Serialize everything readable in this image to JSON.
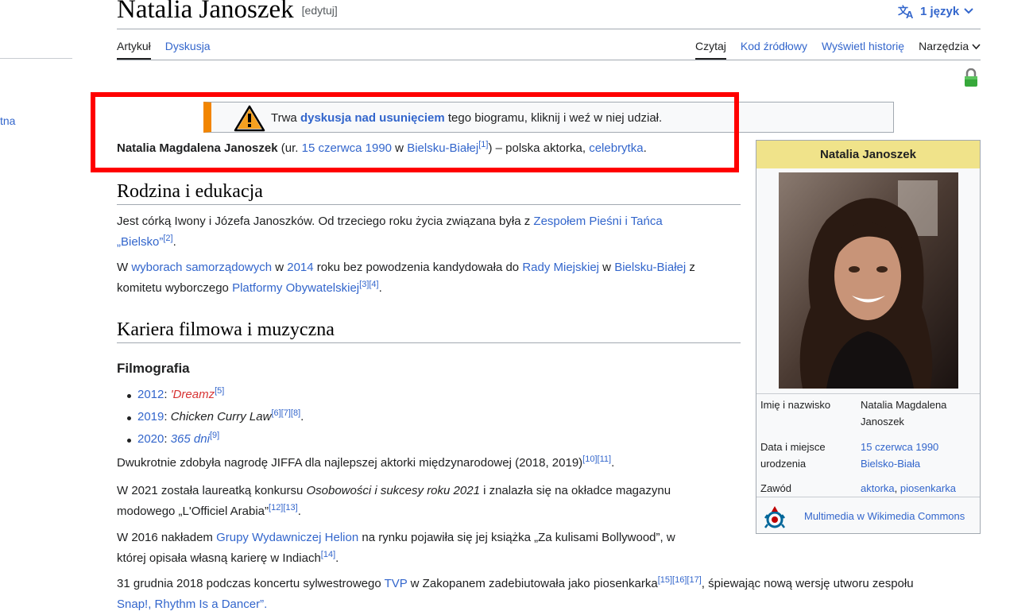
{
  "sidebar": {
    "partial_link": "tna"
  },
  "header": {
    "title": "Natalia Janoszek",
    "edit_label": "[edytuj]",
    "languages_label": "1 język"
  },
  "tabs": {
    "left": [
      "Artykuł",
      "Dyskusja"
    ],
    "right": [
      "Czytaj",
      "Kod źródłowy",
      "Wyświetl historię",
      "Narzędzia"
    ]
  },
  "notice": {
    "prefix": "Trwa ",
    "link": "dyskusja nad usunięciem",
    "suffix": " tego biogramu, kliknij i weź w niej udział."
  },
  "lead": {
    "name": "Natalia Magdalena Janoszek",
    "t1": " (ur. ",
    "birth_date": "15 czerwca 1990",
    "t2": " w ",
    "birth_place": "Bielsku-Białej",
    "ref1": "[1]",
    "t3": ") – polska aktorka, ",
    "celeb": "celebrytka",
    "t4": "."
  },
  "section1": {
    "heading": "Rodzina i edukacja",
    "p1": {
      "t1": "Jest córką Iwony i Józefa Janoszków. Od trzeciego roku życia związana była z ",
      "link1": "Zespołem Pieśni i Tańca",
      "link2": "„Bielsko”",
      "ref": "[2]",
      "t2": "."
    },
    "p2": {
      "t1": "W ",
      "link1": "wyborach samorządowych",
      "t2": " w ",
      "link2": "2014",
      "t3": " roku bez powodzenia kandydowała do ",
      "link3": "Rady Miejskiej",
      "t4": " w ",
      "link4": "Bielsku-Białej",
      "t5": " z",
      "t6": "komitetu wyborczego ",
      "link5": "Platformy Obywatelskiej",
      "ref1": "[3]",
      "ref2": "[4]",
      "t7": "."
    }
  },
  "section2": {
    "heading": "Kariera filmowa i muzyczna",
    "subheading": "Filmografia",
    "films": [
      {
        "year": "2012",
        "sep": ": ",
        "title": "'Dreamz",
        "refs": "[5]",
        "end": ""
      },
      {
        "year": "2019",
        "sep": ": ",
        "title": "Chicken Curry Law",
        "refs": "[6][7][8]",
        "end": "."
      },
      {
        "year": "2020",
        "sep": ": ",
        "title": "365 dni",
        "refs": "[9]",
        "end": ""
      }
    ],
    "p1": {
      "t1": "Dwukrotnie zdobyła nagrodę JIFFA dla najlepszej aktorki międzynarodowej (2018, 2019)",
      "refs": "[10][11]",
      "t2": "."
    },
    "p2": {
      "t1": "W 2021 została laureatką konkursu ",
      "em": "Osobowości i sukcesy roku 2021",
      "t2": " i znalazła się na okładce magazynu",
      "t3": "modowego „L'Officiel Arabia”",
      "refs": "[12][13]",
      "t4": "."
    },
    "p3": {
      "t1": "W 2016 nakładem ",
      "link": "Grupy Wydawniczej Helion",
      "t2": " na rynku pojawiła się jej książka „Za kulisami Bollywood”, w",
      "t3": "której opisała własną karierę w Indiach",
      "refs": "[14]",
      "t4": "."
    },
    "p4": {
      "t1": "31 grudnia 2018 podczas koncertu sylwestrowego ",
      "link": "TVP",
      "t2": " w Zakopanem zadebiutowała jako piosenkarka",
      "refs": "[15][16][17]",
      "t3": ", śpiewając nową wersję utworu zespołu",
      "t4": "Snap!, Rhythm Is a Dancer”."
    }
  },
  "infobox": {
    "title": "Natalia Janoszek",
    "name_label": "Imię i nazwisko",
    "name_value1": "Natalia Magdalena",
    "name_value2": "Janoszek",
    "birth_label1": "Data i miejsce",
    "birth_label2": "urodzenia",
    "birth_date": "15 czerwca 1990",
    "birth_place": "Bielsko-Biała",
    "job_label": "Zawód",
    "job1": "aktorka",
    "job_sep": ", ",
    "job2": "piosenkarka",
    "commons": "Multimedia w Wikimedia Commons"
  },
  "colors": {
    "link": "#3366cc",
    "notice_accent": "#f28500",
    "infobox_header": "#f0e38a",
    "highlight": "#ff0000"
  }
}
